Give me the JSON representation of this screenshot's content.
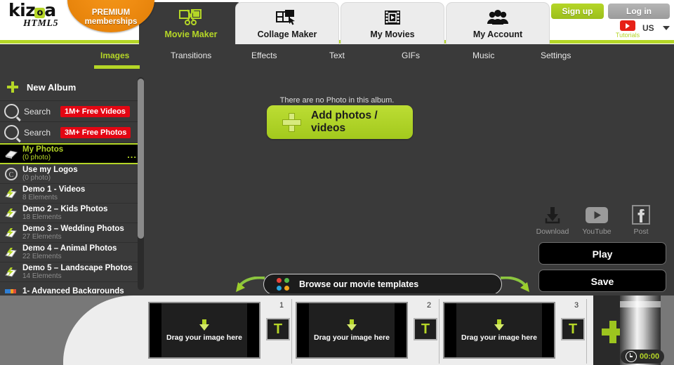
{
  "brand": {
    "logo_main": "kiz",
    "logo_o": "o",
    "logo_main_end": "a",
    "logo_sub": "HTML5",
    "premium_line1": "PREMIUM",
    "premium_line2": "memberships",
    "accent_green": "#b5d627",
    "accent_orange": "#ef8c12",
    "badge_red": "#e30613"
  },
  "header": {
    "tabs": [
      {
        "label": "Movie Maker",
        "icon": "scissors-film-icon",
        "active": true
      },
      {
        "label": "Collage Maker",
        "icon": "collage-cursor-icon",
        "active": false
      },
      {
        "label": "My Movies",
        "icon": "film-reel-icon",
        "active": false
      },
      {
        "label": "My Account",
        "icon": "people-group-icon",
        "active": false
      }
    ],
    "signup_label": "Sign up",
    "login_label": "Log in",
    "tutorials_label": "Tutorials",
    "tutorials_icon": "youtube-icon",
    "locale": "US",
    "locale_caret": "chevron-down-icon"
  },
  "subnav": {
    "items": [
      {
        "label": "Images",
        "active": true
      },
      {
        "label": "Transitions",
        "active": false
      },
      {
        "label": "Effects",
        "active": false
      },
      {
        "label": "Text",
        "active": false
      },
      {
        "label": "GIFs",
        "active": false
      },
      {
        "label": "Music",
        "active": false
      },
      {
        "label": "Settings",
        "active": false
      }
    ]
  },
  "sidebar": {
    "new_album_label": "New Album",
    "new_album_icon": "plus-icon",
    "searches": [
      {
        "label": "Search",
        "badge": "1M+ Free Videos",
        "icon": "search-icon"
      },
      {
        "label": "Search",
        "badge": "3M+ Free Photos",
        "icon": "search-icon"
      }
    ],
    "albums": [
      {
        "name": "My Photos",
        "sub": "(0 photo)",
        "icon": "photo-stack-icon",
        "selected": true,
        "menu": "..."
      },
      {
        "name": "Use my Logos",
        "sub": "(0 photo)",
        "icon": "copyright-icon",
        "selected": false
      },
      {
        "name": "Demo 1 - Videos",
        "sub": "8 Elements",
        "icon": "demo-album-icon",
        "selected": false
      },
      {
        "name": "Demo 2 – Kids Photos",
        "sub": "18 Elements",
        "icon": "demo-album-icon",
        "selected": false
      },
      {
        "name": "Demo 3 – Wedding Photos",
        "sub": "27 Elements",
        "icon": "demo-album-icon",
        "selected": false
      },
      {
        "name": "Demo 4 – Animal Photos",
        "sub": "22 Elements",
        "icon": "demo-album-icon",
        "selected": false
      },
      {
        "name": "Demo 5 – Landscape Photos",
        "sub": "14 Elements",
        "icon": "demo-album-icon",
        "selected": false
      },
      {
        "name": "1- Advanced Backgrounds",
        "sub": "",
        "icon": "backgrounds-icon",
        "selected": false
      }
    ]
  },
  "stage": {
    "empty_message": "There are no Photo in this album.",
    "add_button_label": "Add photos / videos",
    "add_button_icon": "plus-icon",
    "share": [
      {
        "label": "Download",
        "icon": "download-icon"
      },
      {
        "label": "YouTube",
        "icon": "youtube-icon"
      },
      {
        "label": "Post",
        "icon": "facebook-icon"
      }
    ],
    "play_label": "Play",
    "save_label": "Save",
    "templates_label": "Browse our movie templates",
    "templates_icon": "color-dots-icon",
    "templates_dots": [
      "#e8443a",
      "#54b948",
      "#29a7de",
      "#f2a61c"
    ]
  },
  "timeline": {
    "slots": [
      {
        "number": "1",
        "text": "Drag your image here",
        "transition": "T",
        "icon": "download-arrow-icon"
      },
      {
        "number": "2",
        "text": "Drag your image here",
        "transition": "T",
        "icon": "download-arrow-icon"
      },
      {
        "number": "3",
        "text": "Drag your image here",
        "transition": "T",
        "icon": "download-arrow-icon"
      }
    ],
    "add_icon": "plus-icon",
    "duration": "00:00",
    "duration_icon": "clock-icon"
  }
}
